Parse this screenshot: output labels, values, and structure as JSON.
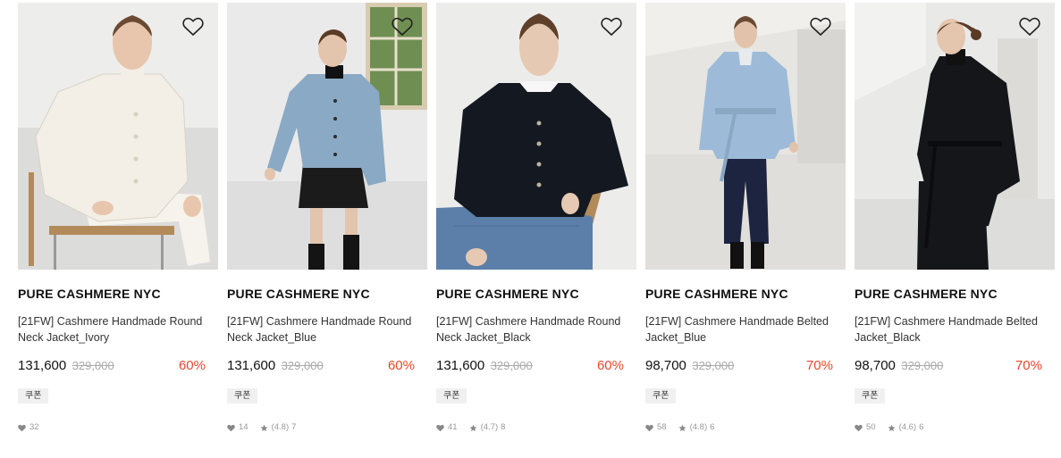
{
  "products": [
    {
      "brand": "PURE CASHMERE NYC",
      "name": "[21FW] Cashmere Handmade Round Neck Jacket_Ivory",
      "price": "131,600",
      "original_price": "329,000",
      "discount": "60%",
      "coupon": "쿠폰",
      "likes": "32",
      "rating": "",
      "reviews": "",
      "jacket_color": "#f3efe6",
      "bottom_color": "#f3efe6",
      "bg_color": "#e7e7e5"
    },
    {
      "brand": "PURE CASHMERE NYC",
      "name": "[21FW] Cashmere Handmade Round Neck Jacket_Blue",
      "price": "131,600",
      "original_price": "329,000",
      "discount": "60%",
      "coupon": "쿠폰",
      "likes": "14",
      "rating": "(4.8)",
      "reviews": "7",
      "jacket_color": "#8aa9c4",
      "bottom_color": "#1b1b1b",
      "bg_color": "#eaeaea"
    },
    {
      "brand": "PURE CASHMERE NYC",
      "name": "[21FW] Cashmere Handmade Round Neck Jacket_Black",
      "price": "131,600",
      "original_price": "329,000",
      "discount": "60%",
      "coupon": "쿠폰",
      "likes": "41",
      "rating": "(4.7)",
      "reviews": "8",
      "jacket_color": "#141820",
      "bottom_color": "#5b7fa8",
      "bg_color": "#ececeb"
    },
    {
      "brand": "PURE CASHMERE NYC",
      "name": "[21FW] Cashmere Handmade Belted Jacket_Blue",
      "price": "98,700",
      "original_price": "329,000",
      "discount": "70%",
      "coupon": "쿠폰",
      "likes": "58",
      "rating": "(4.8)",
      "reviews": "6",
      "jacket_color": "#9dbbd8",
      "bottom_color": "#1c2440",
      "bg_color": "#dfdedb"
    },
    {
      "brand": "PURE CASHMERE NYC",
      "name": "[21FW] Cashmere Handmade Belted Jacket_Black",
      "price": "98,700",
      "original_price": "329,000",
      "discount": "70%",
      "coupon": "쿠폰",
      "likes": "50",
      "rating": "(4.6)",
      "reviews": "6",
      "jacket_color": "#15161a",
      "bottom_color": "#15161a",
      "bg_color": "#e9e9e8"
    }
  ],
  "icons": {
    "wishlist": "heart-outline-icon",
    "likes": "heart-filled-icon",
    "rating": "star-icon"
  },
  "colors": {
    "discount": "#e8472a",
    "original_price": "#aaaaaa",
    "meta": "#999999",
    "coupon_bg": "#f0f0f0"
  }
}
